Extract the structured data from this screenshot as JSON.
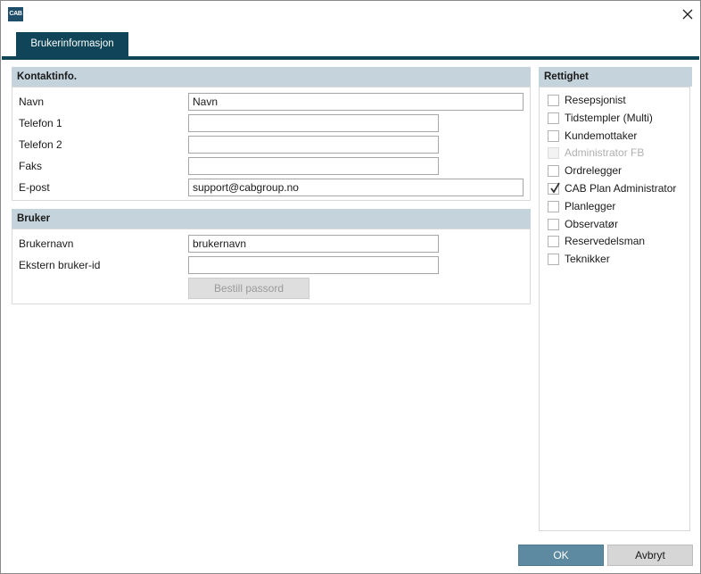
{
  "window": {
    "app_icon_text": "CAB",
    "close_symbol": "✕"
  },
  "tabs": [
    {
      "label": "Brukerinformasjon",
      "active": true
    }
  ],
  "contact": {
    "title": "Kontaktinfo.",
    "fields": [
      {
        "label": "Navn",
        "value": "Navn"
      },
      {
        "label": "Telefon 1",
        "value": ""
      },
      {
        "label": "Telefon 2",
        "value": ""
      },
      {
        "label": "Faks",
        "value": ""
      },
      {
        "label": "E-post",
        "value": "support@cabgroup.no"
      }
    ]
  },
  "user": {
    "title": "Bruker",
    "fields": [
      {
        "label": "Brukernavn",
        "value": "brukernavn"
      },
      {
        "label": "Ekstern bruker-id",
        "value": ""
      }
    ],
    "order_password_label": "Bestill passord"
  },
  "rights": {
    "title": "Rettighet",
    "items": [
      {
        "label": "Resepsjonist",
        "checked": false,
        "disabled": false
      },
      {
        "label": "Tidstempler (Multi)",
        "checked": false,
        "disabled": false
      },
      {
        "label": "Kundemottaker",
        "checked": false,
        "disabled": false
      },
      {
        "label": "Administrator FB",
        "checked": false,
        "disabled": true
      },
      {
        "label": "Ordrelegger",
        "checked": false,
        "disabled": false
      },
      {
        "label": "CAB Plan Administrator",
        "checked": true,
        "disabled": false
      },
      {
        "label": "Planlegger",
        "checked": false,
        "disabled": false
      },
      {
        "label": "Observatør",
        "checked": false,
        "disabled": false
      },
      {
        "label": "Reservedelsman",
        "checked": false,
        "disabled": false
      },
      {
        "label": "Teknikker",
        "checked": false,
        "disabled": false
      }
    ]
  },
  "footer": {
    "ok_label": "OK",
    "cancel_label": "Avbryt"
  },
  "colors": {
    "accent": "#0f4459",
    "group_header": "#c4d3dc",
    "ok_button": "#5d8aa0",
    "check": "#333333"
  }
}
